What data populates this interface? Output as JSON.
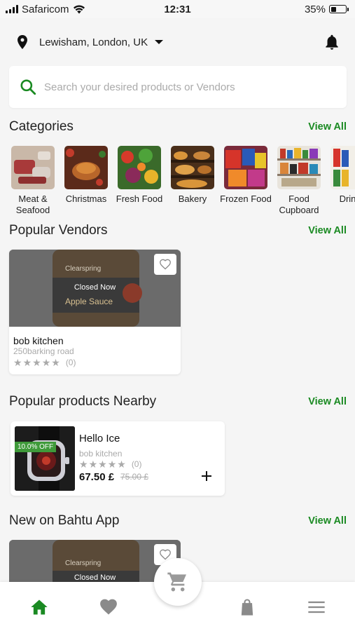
{
  "status_bar": {
    "carrier": "Safaricom",
    "time": "12:31",
    "battery": "35%",
    "battery_level": 0.35
  },
  "location": {
    "label": "Lewisham, London, UK",
    "pin_icon": "location-pin-icon",
    "dropdown_icon": "caret-down-icon",
    "notification_icon": "bell-icon"
  },
  "search": {
    "placeholder": "Search your desired products or Vendors",
    "icon": "search-icon"
  },
  "colors": {
    "accent": "#1a8a22",
    "discount_badge": "#3f9a3a"
  },
  "categories": {
    "title": "Categories",
    "view_all": "View All",
    "items": [
      {
        "label": "Meat & Seafood"
      },
      {
        "label": "Christmas"
      },
      {
        "label": "Fresh Food"
      },
      {
        "label": "Bakery"
      },
      {
        "label": "Frozen Food"
      },
      {
        "label": "Food Cupboard"
      },
      {
        "label": "Drinks"
      }
    ]
  },
  "popular_vendors": {
    "title": "Popular Vendors",
    "view_all": "View All",
    "vendor": {
      "status": "Closed Now",
      "name": "bob kitchen",
      "address": "250barking road",
      "rating_count": "(0)",
      "stars": 0
    }
  },
  "popular_products": {
    "title": "Popular products Nearby",
    "view_all": "View All",
    "product": {
      "discount": "10.0% OFF",
      "name": "Hello Ice",
      "vendor": "bob kitchen",
      "rating_count": "(0)",
      "price": "67.50 £",
      "old_price": "75.00 £"
    }
  },
  "new_on_app": {
    "title": "New on Bahtu App",
    "view_all": "View All",
    "status": "Closed Now"
  },
  "bottom_nav": {
    "items": [
      "home-icon",
      "heart-icon",
      "cart-icon",
      "bag-icon",
      "menu-icon"
    ]
  }
}
